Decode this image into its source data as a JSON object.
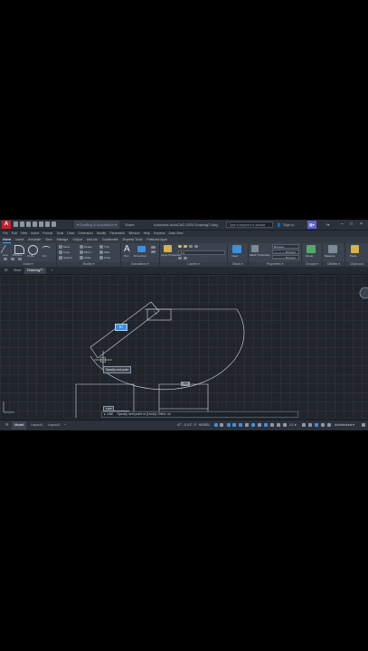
{
  "app": {
    "logo": "A",
    "title": "Autodesk AutoCAD 2024   Drawing7.dwg",
    "share_label": "Share",
    "search_placeholder": "Type a keyword or phrase",
    "signin_label": "Sign In"
  },
  "menu": [
    "File",
    "Edit",
    "View",
    "Insert",
    "Format",
    "Tools",
    "Draw",
    "Dimension",
    "Modify",
    "Parametric",
    "Window",
    "Help",
    "Express",
    "Data View"
  ],
  "ribbon_tabs": [
    {
      "label": "Home",
      "active": true
    },
    {
      "label": "Insert"
    },
    {
      "label": "Annotate"
    },
    {
      "label": "View"
    },
    {
      "label": "Manage"
    },
    {
      "label": "Output"
    },
    {
      "label": "Add-ins"
    },
    {
      "label": "Collaborate"
    },
    {
      "label": "Express Tools"
    },
    {
      "label": "Featured Apps"
    }
  ],
  "ribbon": {
    "draw_title": "Draw ▾",
    "modify_title": "Modify ▾",
    "annotation_title": "Annotation ▾",
    "layers_title": "Layers ▾",
    "block_title": "Block ▾",
    "properties_title": "Properties ▾",
    "groups_title": "Groups ▾",
    "utilities_title": "Utilities ▾",
    "clipboard_title": "Clipboard",
    "line_label": "Line",
    "polyline_label": "Polyline",
    "circle_label": "Circle",
    "arc_label": "Arc",
    "move_label": "Move",
    "copy_label": "Copy",
    "stretch_label": "Stretch",
    "rotate_label": "Rotate",
    "mirror_label": "Mirror",
    "scale_label": "Scale",
    "trim_label": "Trim",
    "fillet_label": "Fillet",
    "array_label": "Array",
    "text_label": "Text",
    "dimension_label": "Dimension",
    "layer_props_label": "Layer Properties",
    "insert_label": "Insert",
    "match_label": "Match Properties",
    "group_label": "Group",
    "measure_label": "Measure",
    "paste_label": "Paste",
    "bylayer_1": "ByLayer",
    "bylayer_2": "———— ByLayer",
    "bylayer_3": "———— ByLayer"
  },
  "file_tabs": {
    "start": "Start",
    "drawing": "Drawing7*",
    "add": "+"
  },
  "drawing": {
    "tooltip_value": "Specify next point",
    "blue_value": "97",
    "gray_value": "180",
    "lower_tooltip_a": "1185",
    "lower_tooltip_b": "Specify first point"
  },
  "command": {
    "prefix": "▸ LINE",
    "text": "Specify next point or [Undo]:   Ortho: on"
  },
  "status": {
    "model_tab": "Model",
    "layout1": "Layout1",
    "layout2": "Layout2",
    "add": "+",
    "coords": "47' - 5 1/2\", 0\"",
    "model": "MODEL",
    "scale": "1:1 ▾",
    "units": "Architectural ▾"
  }
}
